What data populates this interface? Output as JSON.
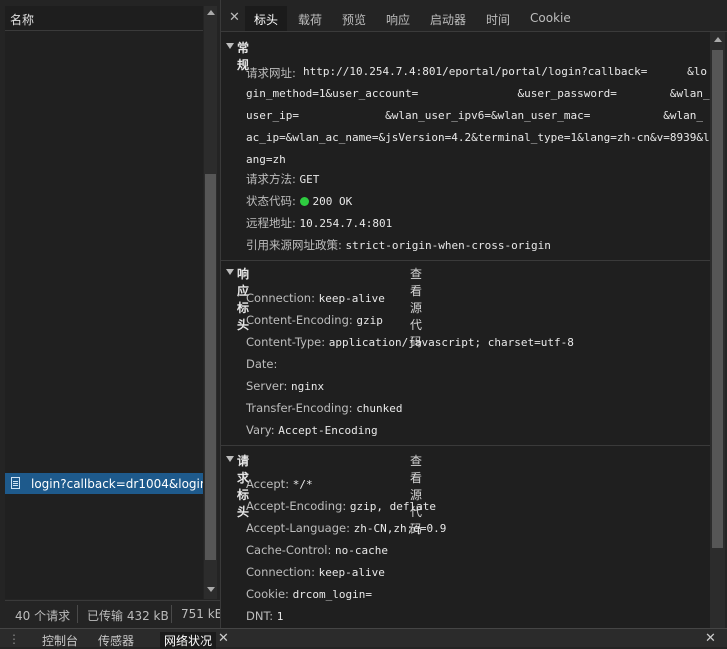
{
  "left": {
    "column_header": "名称",
    "selected_request": "login?callback=dr1004&login_method=1&user_account=",
    "status": {
      "requests": "40 个请求",
      "transferred": "已传输 432 kB",
      "resources": "751 kB"
    }
  },
  "tabs": [
    "标头",
    "载荷",
    "预览",
    "响应",
    "启动器",
    "时间",
    "Cookie"
  ],
  "general": {
    "title": "常规",
    "url_key": "请求网址:",
    "url_lines": [
      "http://10.254.7.4:801/eportal/portal/login?callback=      &lo",
      "gin_method=1&user_account=               &user_password=        &wlan_",
      "user_ip=             &wlan_user_ipv6=&wlan_user_mac=           &wlan_",
      "ac_ip=&wlan_ac_name=&jsVersion=4.2&terminal_type=1&lang=zh-cn&v=8939&l",
      "ang=zh"
    ],
    "method_key": "请求方法:",
    "method": "GET",
    "status_key": "状态代码:",
    "status": "200 OK",
    "remote_key": "远程地址:",
    "remote": "10.254.7.4:801",
    "referrer_key": "引用来源网址政策:",
    "referrer": "strict-origin-when-cross-origin"
  },
  "response_headers": {
    "title": "响应标头",
    "view_source": "查看源代码",
    "items": [
      {
        "k": "Connection:",
        "v": "keep-alive"
      },
      {
        "k": "Content-Encoding:",
        "v": "gzip"
      },
      {
        "k": "Content-Type:",
        "v": "application/javascript; charset=utf-8"
      },
      {
        "k": "Date:",
        "v": ""
      },
      {
        "k": "Server:",
        "v": "nginx"
      },
      {
        "k": "Transfer-Encoding:",
        "v": "chunked"
      },
      {
        "k": "Vary:",
        "v": "Accept-Encoding"
      }
    ]
  },
  "request_headers": {
    "title": "请求标头",
    "view_source": "查看源代码",
    "items": [
      {
        "k": "Accept:",
        "v": "*/*"
      },
      {
        "k": "Accept-Encoding:",
        "v": "gzip, deflate"
      },
      {
        "k": "Accept-Language:",
        "v": "zh-CN,zh;q=0.9"
      },
      {
        "k": "Cache-Control:",
        "v": "no-cache"
      },
      {
        "k": "Connection:",
        "v": "keep-alive"
      },
      {
        "k": "Cookie:",
        "v": "drcom_login="
      },
      {
        "k": "DNT:",
        "v": "1"
      }
    ]
  },
  "drawer": {
    "tabs": [
      "控制台",
      "传感器",
      "网络状况"
    ]
  },
  "colors": {
    "selected_row": "#1e5a8c",
    "status_ok": "#2ecc40",
    "background": "#1f1f1f"
  },
  "icons": [
    "file-icon",
    "close-icon",
    "expand-triangle-icon"
  ]
}
